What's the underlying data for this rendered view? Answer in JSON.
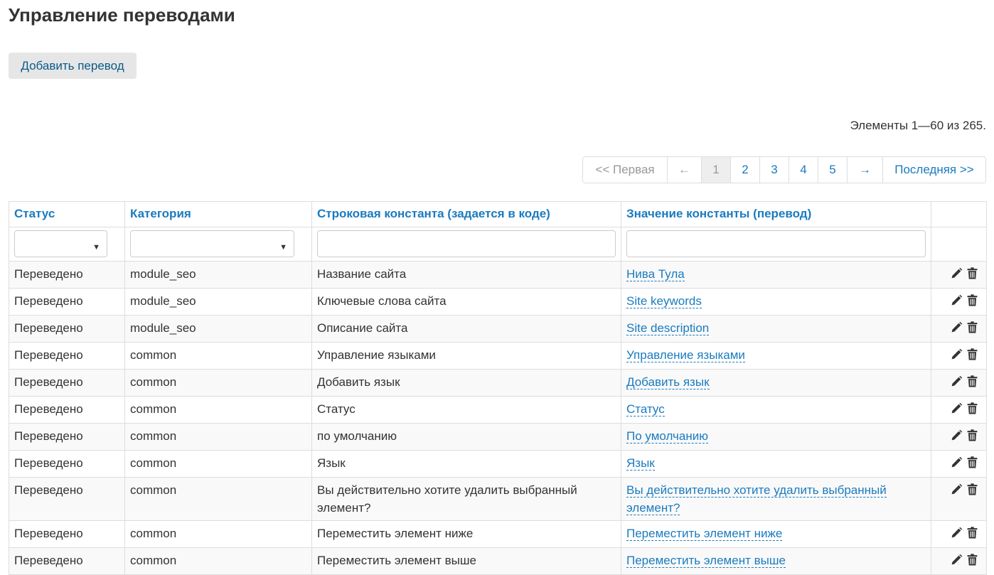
{
  "page": {
    "title": "Управление переводами",
    "add_button_label": "Добавить перевод",
    "summary": "Элементы 1—60 из 265."
  },
  "pagination": {
    "first": "<< Первая",
    "prev": "←",
    "pages": [
      "1",
      "2",
      "3",
      "4",
      "5"
    ],
    "current": "1",
    "next": "→",
    "last": "Последняя >>"
  },
  "table": {
    "columns": [
      "Статус",
      "Категория",
      "Строковая константа (задается в коде)",
      "Значение константы (перевод)"
    ],
    "filters": {
      "status_selected": "",
      "category_selected": "",
      "constant_value": "",
      "translation_value": ""
    },
    "rows": [
      {
        "status": "Переведено",
        "category": "module_seo",
        "constant": "Название сайта",
        "value": "Нива Тула",
        "lines": 1
      },
      {
        "status": "Переведено",
        "category": "module_seo",
        "constant": "Ключевые слова сайта",
        "value": "Site keywords",
        "lines": 1
      },
      {
        "status": "Переведено",
        "category": "module_seo",
        "constant": "Описание сайта",
        "value": "Site description",
        "lines": 1
      },
      {
        "status": "Переведено",
        "category": "common",
        "constant": "Управление языками",
        "value": "Управление языками",
        "lines": 1
      },
      {
        "status": "Переведено",
        "category": "common",
        "constant": "Добавить язык",
        "value": "Добавить язык",
        "lines": 1
      },
      {
        "status": "Переведено",
        "category": "common",
        "constant": "Статус",
        "value": "Статус",
        "lines": 1
      },
      {
        "status": "Переведено",
        "category": "common",
        "constant": "по умолчанию",
        "value": "По умолчанию",
        "lines": 1
      },
      {
        "status": "Переведено",
        "category": "common",
        "constant": "Язык",
        "value": "Язык",
        "lines": 1
      },
      {
        "status": "Переведено",
        "category": "common",
        "constant": "Вы действительно хотите удалить выбранный элемент?",
        "value": "Вы действительно хотите удалить выбранный элемент?",
        "lines": 2
      },
      {
        "status": "Переведено",
        "category": "common",
        "constant": "Переместить элемент ниже",
        "value": "Переместить элемент ниже",
        "lines": 1
      },
      {
        "status": "Переведено",
        "category": "common",
        "constant": "Переместить элемент выше",
        "value": "Переместить элемент выше",
        "lines": 1
      }
    ]
  },
  "icons": {
    "edit": "pencil-icon",
    "delete": "trash-icon"
  },
  "colors": {
    "link": "#1a7bbf",
    "header_text": "#1a7bbf",
    "button_bg": "#e6e6e6",
    "stripe": "#f9f9f9",
    "border": "#dddddd"
  }
}
